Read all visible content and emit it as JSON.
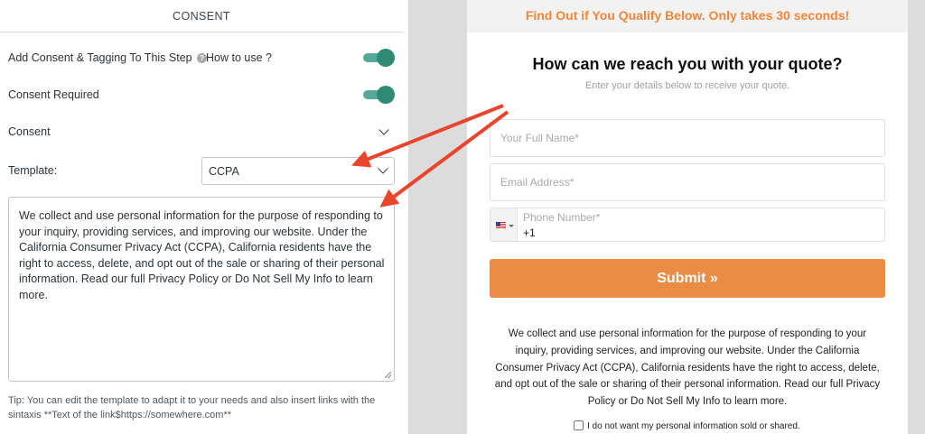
{
  "consent_panel": {
    "section_title": "CONSENT",
    "add_consent_label": "Add Consent & Tagging To This Step",
    "info_icon_glyph": "?",
    "how_to_use": "How to use ?",
    "consent_required_label": "Consent Required",
    "consent_label": "Consent",
    "template_label": "Template:",
    "template_value": "CCPA",
    "consent_text": "We collect and use personal information for the purpose of responding to your inquiry, providing services, and improving our website. Under the California Consumer Privacy Act (CCPA), California residents have the right to access, delete, and opt out of the sale or sharing of their personal information. Read our full Privacy Policy or Do Not Sell My Info to learn more.",
    "tip": "Tip: You can edit the template to adapt it to your needs and also insert links with the sintaxis **Text of the link$https://somewhere.com**",
    "toggle_color": "#2f8a73"
  },
  "preview": {
    "banner": "Find Out if You Qualify Below. Only takes 30 seconds!",
    "title": "How can we reach you with your quote?",
    "subtitle": "Enter your details below to receive your quote.",
    "name_placeholder": "Your Full Name*",
    "email_placeholder": "Email Address*",
    "phone_label": "Phone Number*",
    "phone_code": "+1",
    "submit_label": "Submit »",
    "consent_text": "We collect and use personal information for the purpose of responding to your inquiry, providing services, and improving our website. Under the California Consumer Privacy Act (CCPA), California residents have the right to access, delete, and opt out of the sale or sharing of their personal information. Read our full Privacy Policy or Do Not Sell My Info to learn more.",
    "optout_label": "I do not want my personal information sold or shared.",
    "accent_color": "#eb8c44"
  },
  "annotation": {
    "arrow_color": "#e8452c"
  }
}
